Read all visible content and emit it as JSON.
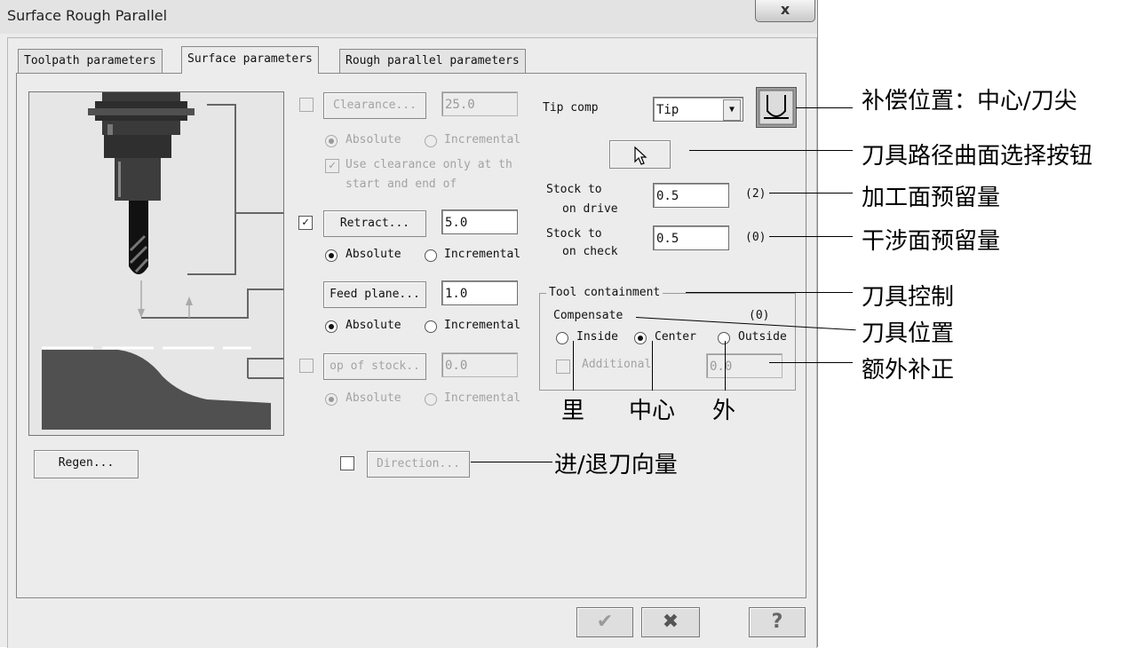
{
  "window": {
    "title": "Surface Rough Parallel",
    "close_glyph": "x"
  },
  "tabs": [
    {
      "label": "Toolpath parameters"
    },
    {
      "label": "Surface parameters"
    },
    {
      "label": "Rough parallel parameters"
    }
  ],
  "clearance": {
    "label": "Clearance...",
    "value": "25.0",
    "checked": false,
    "absolute": "Absolute",
    "incremental": "Incremental",
    "use_clearance_line1": "Use clearance only at th",
    "use_clearance_line2": "start and end of"
  },
  "retract": {
    "label": "Retract...",
    "value": "5.0",
    "checked": true,
    "absolute": "Absolute",
    "incremental": "Incremental"
  },
  "feed_plane": {
    "label": "Feed plane...",
    "value": "1.0",
    "absolute": "Absolute",
    "incremental": "Incremental"
  },
  "top_of_stock": {
    "label": "op of stock..",
    "value": "0.0",
    "absolute": "Absolute",
    "incremental": "Incremental"
  },
  "tip_comp": {
    "label": "Tip comp",
    "value": "Tip"
  },
  "stock_drive": {
    "label_line1": "Stock to",
    "label_line2": "on drive",
    "value": "0.5",
    "count": "(2)"
  },
  "stock_check": {
    "label_line1": "Stock to",
    "label_line2": "on check",
    "value": "0.5",
    "count": "(0)"
  },
  "containment": {
    "legend": "Tool containment",
    "compensate": "Compensate",
    "count": "(0)",
    "inside": "Inside",
    "center": "Center",
    "outside": "Outside",
    "additional": "Additional",
    "value": "0.0"
  },
  "buttons": {
    "regen": "Regen...",
    "direction": "Direction..."
  },
  "annotations": {
    "comp_position": "补偿位置：中心/刀尖",
    "select_surface": "刀具路径曲面选择按钮",
    "drive_stock": "加工面预留量",
    "check_stock": "干涉面预留量",
    "tool_control": "刀具控制",
    "tool_position": "刀具位置",
    "extra_comp": "额外补正",
    "inside": "里",
    "center": "中心",
    "outside": "外",
    "direction": "进/退刀向量"
  }
}
